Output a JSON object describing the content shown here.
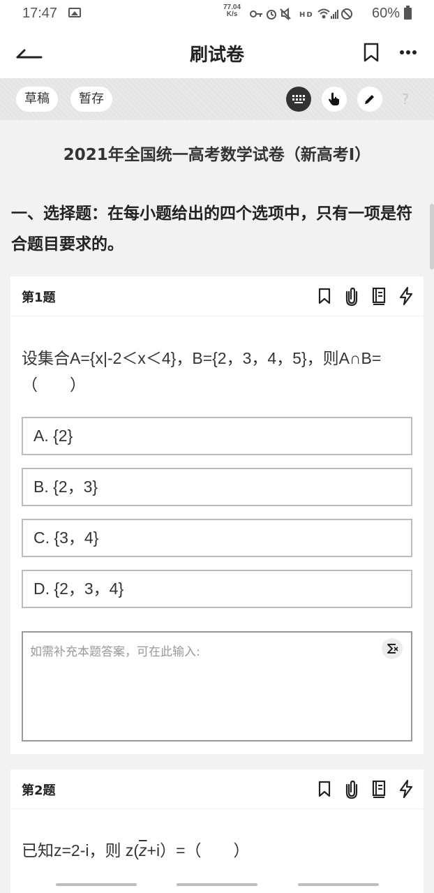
{
  "status_bar": {
    "time": "17:47",
    "net_speed_value": "77.04",
    "net_speed_unit": "K/s",
    "battery": "60%"
  },
  "header": {
    "title": "刷试卷"
  },
  "toolbar": {
    "draft_label": "草稿",
    "save_label": "暂存",
    "help_glyph": "?"
  },
  "exam": {
    "title": "2021年全国统一高考数学试卷（新高考I）",
    "section_heading": "一、选择题：在每小题给出的四个选项中，只有一项是符合题目要求的。"
  },
  "questions": [
    {
      "label": "第1题",
      "text": "设集合A={x|-2＜x＜4}，B={2，3，4，5}，则A∩B=（　　）",
      "options": [
        "A. {2}",
        "B. {2，3}",
        "C. {3，4}",
        "D. {2，3，4}"
      ],
      "answer_placeholder": "如需补充本题答案，可在此输入:"
    },
    {
      "label": "第2题",
      "text_before": "已知z=2-i，则 z(",
      "conj_symbol": "z",
      "text_after": "+i）=（　　）"
    }
  ],
  "colors": {
    "page_bg": "#f2f2f2",
    "toolbar_bg": "#e8e8e8",
    "keyboard_button_bg": "#333333",
    "option_border": "#bbbbbb"
  }
}
